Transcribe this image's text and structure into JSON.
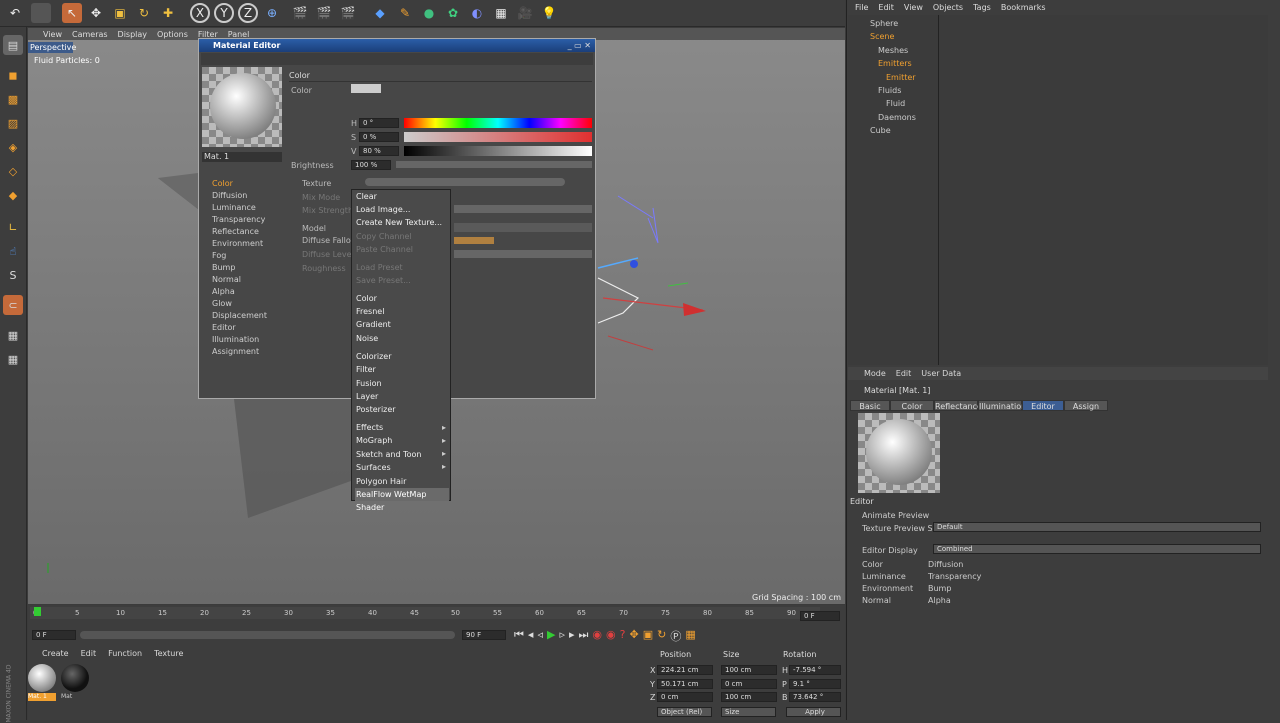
{
  "toolbar": {
    "x": "X",
    "y": "Y",
    "z": "Z"
  },
  "viewport": {
    "menu": [
      "View",
      "Cameras",
      "Display",
      "Options",
      "Filter",
      "Panel"
    ],
    "label": "Perspective",
    "fluid": "Fluid Particles: 0",
    "grid": "Grid Spacing : 100 cm"
  },
  "editor": {
    "title": "Material Editor",
    "mat_name": "Mat. 1",
    "section": "Color",
    "color_label": "Color",
    "h": "H",
    "h_val": "0 °",
    "s": "S",
    "s_val": "0 %",
    "v": "V",
    "v_val": "80 %",
    "brightness": "Brightness",
    "brightness_val": "100 %",
    "texture": "Texture",
    "mix_mode": "Mix Mode",
    "mix_strength": "Mix Strength",
    "model": "Model",
    "diffuse_falloff": "Diffuse Falloff",
    "diffuse_level": "Diffuse Level",
    "roughness": "Roughness",
    "channels": [
      "Color",
      "Diffusion",
      "Luminance",
      "Transparency",
      "Reflectance",
      "Environment",
      "Fog",
      "Bump",
      "Normal",
      "Alpha",
      "Glow",
      "Displacement",
      "Editor",
      "Illumination",
      "Assignment"
    ]
  },
  "context_menu": {
    "group1": [
      "Clear",
      "Load Image...",
      "Create New Texture..."
    ],
    "disabled1": [
      "Copy Channel",
      "Paste Channel"
    ],
    "disabled2": [
      "Load Preset",
      "Save Preset..."
    ],
    "group2": [
      "Color",
      "Fresnel",
      "Gradient",
      "Noise"
    ],
    "group3": [
      "Colorizer",
      "Filter",
      "Fusion",
      "Layer",
      "Posterizer"
    ],
    "submenus": [
      "Effects",
      "MoGraph",
      "Sketch and Toon",
      "Surfaces"
    ],
    "group4": [
      "Polygon Hair"
    ],
    "highlighted": "RealFlow WetMap Shader"
  },
  "objects": {
    "menu": [
      "File",
      "Edit",
      "View",
      "Objects",
      "Tags",
      "Bookmarks"
    ],
    "items": [
      "Sphere",
      "Scene",
      "Meshes",
      "Emitters",
      "Emitter",
      "Fluids",
      "Fluid",
      "Daemons",
      "Cube"
    ]
  },
  "attributes": {
    "menu": [
      "Mode",
      "Edit",
      "User Data"
    ],
    "material": "Material [Mat. 1]",
    "tabs": [
      "Basic",
      "Color",
      "Reflectance",
      "Illumination",
      "Editor",
      "Assign"
    ],
    "section": "Editor",
    "animate_preview": "Animate Preview",
    "tex_preview_size": "Texture Preview Size",
    "tex_preview_val": "Default",
    "editor_display": "Editor Display",
    "editor_display_val": "Combined",
    "display_left": [
      "Color",
      "Luminance",
      "Environment",
      "Normal"
    ],
    "display_right": [
      "Diffusion",
      "Transparency",
      "Bump",
      "Alpha"
    ]
  },
  "timeline": {
    "ticks": [
      "0",
      "5",
      "10",
      "15",
      "20",
      "25",
      "30",
      "35",
      "40",
      "45",
      "50",
      "55",
      "60",
      "65",
      "70",
      "75",
      "80",
      "85",
      "90"
    ],
    "frame_end": "0 F",
    "start": "0 F",
    "end1": "90 F",
    "end2": "90 F"
  },
  "materials": {
    "menu": [
      "Create",
      "Edit",
      "Function",
      "Texture"
    ],
    "mat1": "Mat. 1",
    "mat2": "Mat"
  },
  "coords": {
    "position": "Position",
    "size": "Size",
    "rotation": "Rotation",
    "x": "X",
    "y": "Y",
    "z": "Z",
    "px": "224.21 cm",
    "py": "50.171 cm",
    "pz": "0 cm",
    "sx": "100 cm",
    "sy": "0 cm",
    "sz": "100 cm",
    "h": "H",
    "p": "P",
    "b": "B",
    "rh": "-7.594 °",
    "rp": "9.1 °",
    "rb": "73.642 °",
    "mode": "Object (Rel)",
    "size_mode": "Size",
    "apply": "Apply"
  },
  "logo": "MAXON CINEMA 4D"
}
